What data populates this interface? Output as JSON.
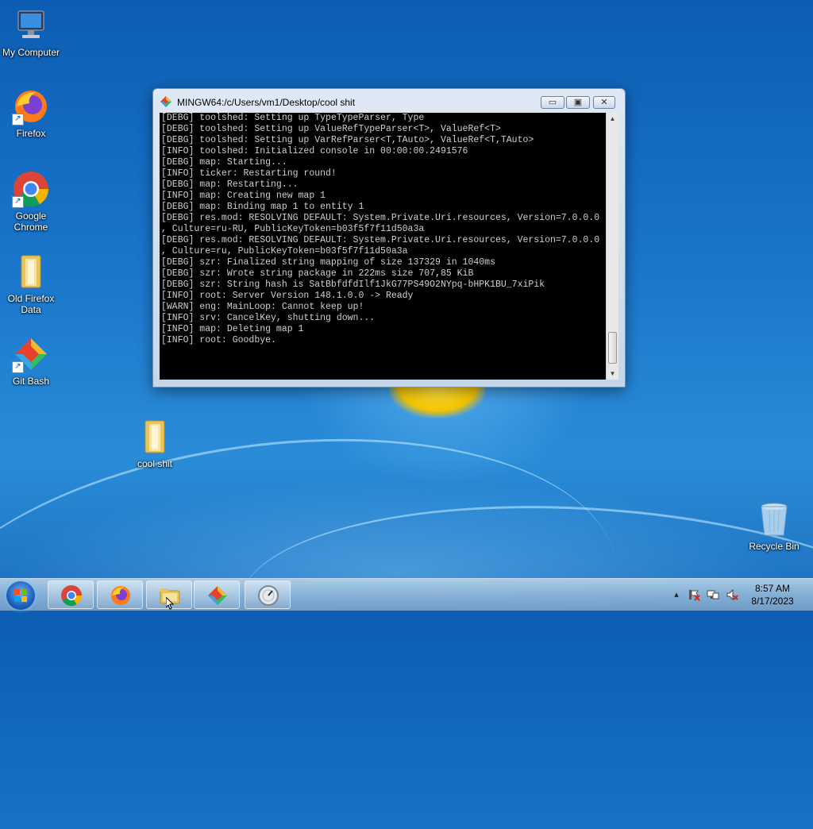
{
  "desktop": {
    "icons": [
      {
        "label": "My Computer",
        "icon": "computer-icon"
      },
      {
        "label": "Firefox",
        "icon": "firefox-icon"
      },
      {
        "label": "Google Chrome",
        "icon": "chrome-icon"
      },
      {
        "label": "Old Firefox Data",
        "icon": "folder-icon"
      },
      {
        "label": "Git Bash",
        "icon": "git-bash-icon"
      },
      {
        "label": "cool shit",
        "icon": "folder-icon"
      },
      {
        "label": "Recycle Bin",
        "icon": "recycle-bin-icon"
      }
    ]
  },
  "window": {
    "title": "MINGW64:/c/Users/vm1/Desktop/cool shit",
    "minimize_label": "▭",
    "maximize_label": "▣",
    "close_label": "✕",
    "console_lines": [
      "[DEBG] toolshed: Setting up TypeTypeParser, Type",
      "[DEBG] toolshed: Setting up ValueRefTypeParser<T>, ValueRef<T>",
      "[DEBG] toolshed: Setting up VarRefParser<T,TAuto>, ValueRef<T,TAuto>",
      "[INFO] toolshed: Initialized console in 00:00:00.2491576",
      "[DEBG] map: Starting...",
      "[INFO] ticker: Restarting round!",
      "[DEBG] map: Restarting...",
      "[INFO] map: Creating new map 1",
      "[DEBG] map: Binding map 1 to entity 1",
      "[DEBG] res.mod: RESOLVING DEFAULT: System.Private.Uri.resources, Version=7.0.0.0",
      ", Culture=ru-RU, PublicKeyToken=b03f5f7f11d50a3a",
      "[DEBG] res.mod: RESOLVING DEFAULT: System.Private.Uri.resources, Version=7.0.0.0",
      ", Culture=ru, PublicKeyToken=b03f5f7f11d50a3a",
      "[DEBG] szr: Finalized string mapping of size 137329 in 1040ms",
      "[DEBG] szr: Wrote string package in 222ms size 707,85 KiB",
      "[DEBG] szr: String hash is SatBbfdfdIlf1JkG77PS49O2NYpq-bHPK1BU_7xiPik",
      "[INFO] root: Server Version 148.1.0.0 -> Ready",
      "[WARN] eng: MainLoop: Cannot keep up!",
      "[INFO] srv: CancelKey, shutting down...",
      "[INFO] map: Deleting map 1",
      "[INFO] root: Goodbye."
    ]
  },
  "taskbar": {
    "pinned": [
      {
        "icon": "chrome-icon"
      },
      {
        "icon": "firefox-icon"
      },
      {
        "icon": "file-explorer-icon"
      },
      {
        "icon": "git-bash-icon"
      },
      {
        "icon": "terminal-icon"
      }
    ],
    "clock": {
      "time": "8:57 AM",
      "date": "8/17/2023"
    },
    "tray_icons": [
      "show-hidden-icons",
      "action-center-icon",
      "network-icon",
      "volume-muted-icon"
    ]
  }
}
